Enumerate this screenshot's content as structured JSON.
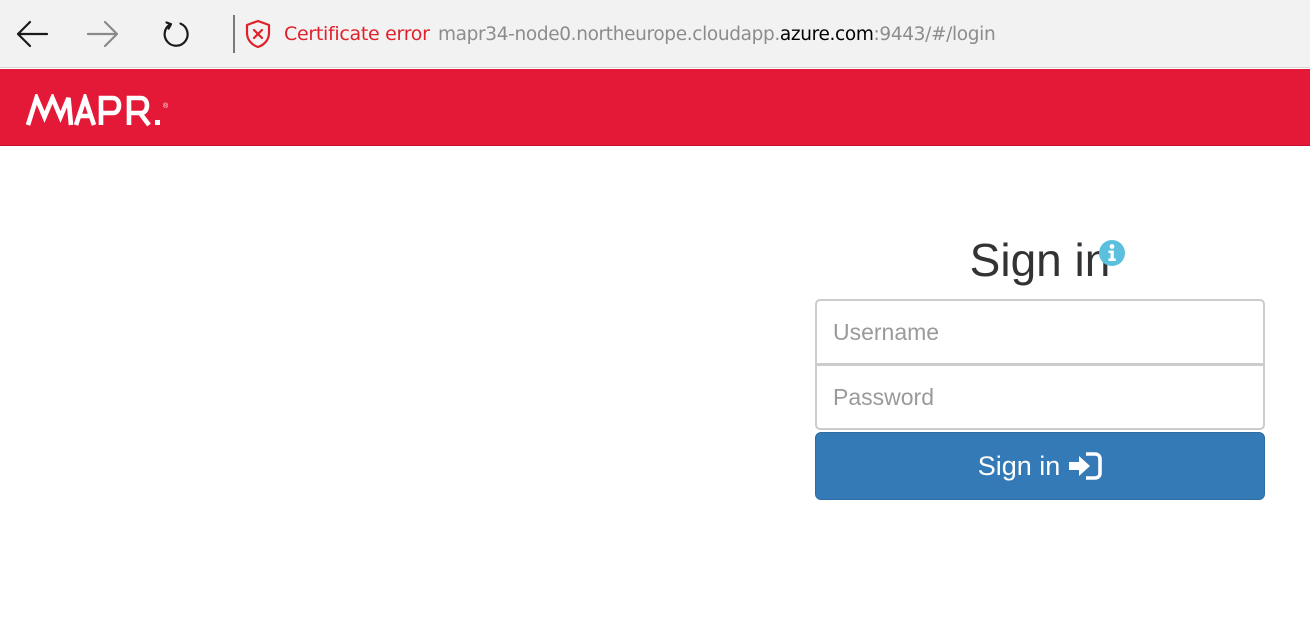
{
  "browser": {
    "cert_label": "Certificate error",
    "url_prefix": "mapr34-node0.northeurope.cloudapp.",
    "url_domain": "azure.com",
    "url_suffix": ":9443/#/login",
    "icons": {
      "back": "arrow-left-icon",
      "forward": "arrow-right-icon",
      "reload": "refresh-icon",
      "cert": "shield-x-icon"
    }
  },
  "header": {
    "logo_text": "MAPR",
    "background_color": "#e41937"
  },
  "login": {
    "title": "Sign in",
    "username_placeholder": "Username",
    "password_placeholder": "Password",
    "button_label": "Sign in",
    "button_color": "#337ab7",
    "info_icon": "info-circle-icon",
    "button_icon": "sign-in-icon"
  }
}
